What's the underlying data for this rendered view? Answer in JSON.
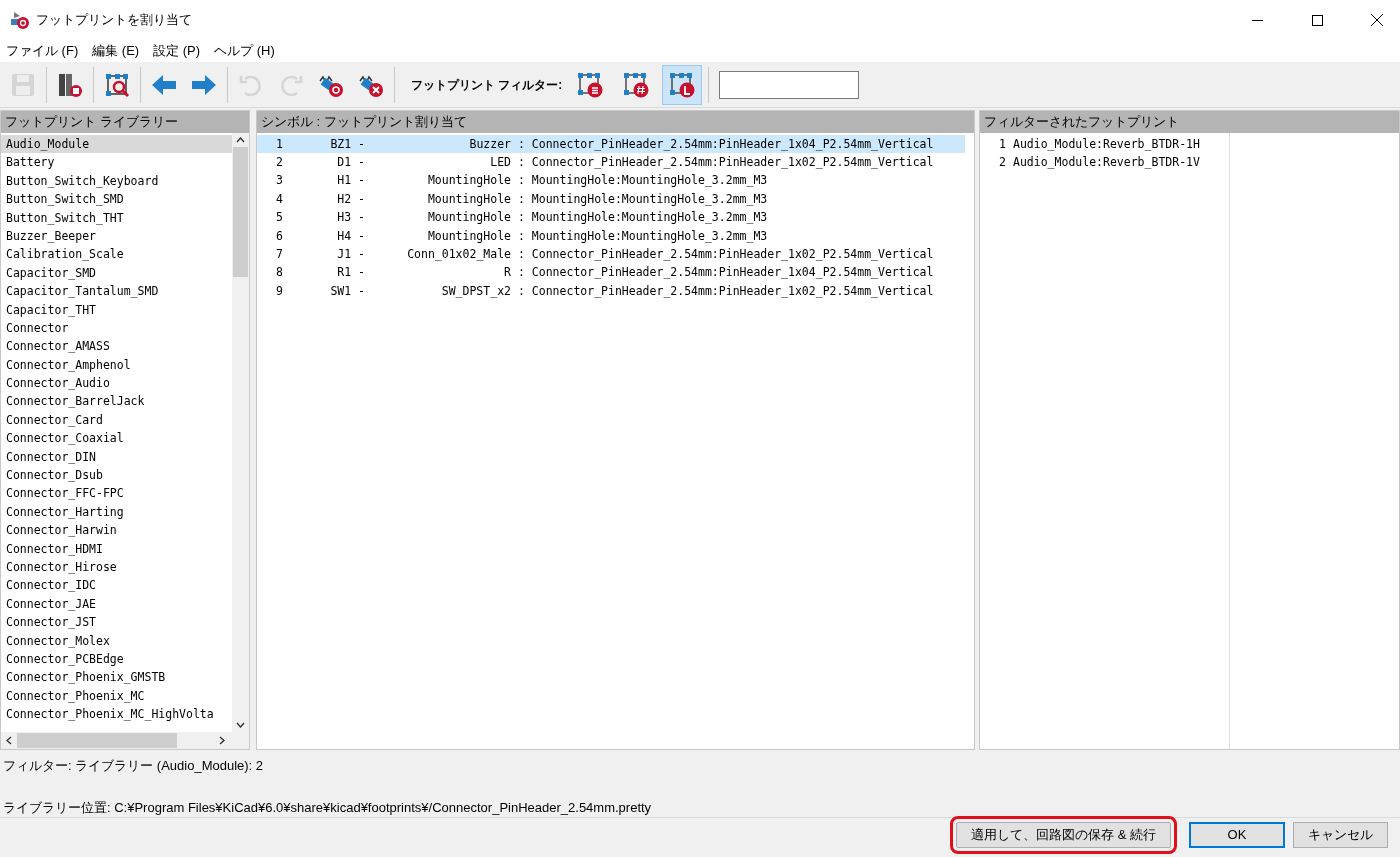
{
  "window": {
    "title": "フットプリントを割り当て"
  },
  "menu": [
    "ファイル (F)",
    "編集 (E)",
    "設定 (P)",
    "ヘルプ (H)"
  ],
  "toolbar": {
    "tools": [
      {
        "kind": "save",
        "disabled": true
      },
      {
        "kind": "library",
        "disabled": false
      },
      {
        "kind": "viewer",
        "disabled": false
      },
      {
        "kind": "prev",
        "disabled": false
      },
      {
        "kind": "next",
        "disabled": false
      },
      {
        "kind": "undo",
        "disabled": true
      },
      {
        "kind": "redo",
        "disabled": true
      },
      {
        "kind": "auto",
        "disabled": false
      },
      {
        "kind": "clear",
        "disabled": false
      }
    ],
    "filter_label": "フットプリント フィルター:",
    "filters": [
      {
        "kind": "keywords",
        "selected": false
      },
      {
        "kind": "pincount",
        "selected": false
      },
      {
        "kind": "library",
        "selected": true
      }
    ]
  },
  "libraries": {
    "title": "フットプリント ライブラリー",
    "items": [
      {
        "label": "Audio_Module",
        "selected": true
      },
      {
        "label": "Battery",
        "selected": false
      },
      {
        "label": "Button_Switch_Keyboard",
        "selected": false
      },
      {
        "label": "Button_Switch_SMD",
        "selected": false
      },
      {
        "label": "Button_Switch_THT",
        "selected": false
      },
      {
        "label": "Buzzer_Beeper",
        "selected": false
      },
      {
        "label": "Calibration_Scale",
        "selected": false
      },
      {
        "label": "Capacitor_SMD",
        "selected": false
      },
      {
        "label": "Capacitor_Tantalum_SMD",
        "selected": false
      },
      {
        "label": "Capacitor_THT",
        "selected": false
      },
      {
        "label": "Connector",
        "selected": false
      },
      {
        "label": "Connector_AMASS",
        "selected": false
      },
      {
        "label": "Connector_Amphenol",
        "selected": false
      },
      {
        "label": "Connector_Audio",
        "selected": false
      },
      {
        "label": "Connector_BarrelJack",
        "selected": false
      },
      {
        "label": "Connector_Card",
        "selected": false
      },
      {
        "label": "Connector_Coaxial",
        "selected": false
      },
      {
        "label": "Connector_DIN",
        "selected": false
      },
      {
        "label": "Connector_Dsub",
        "selected": false
      },
      {
        "label": "Connector_FFC-FPC",
        "selected": false
      },
      {
        "label": "Connector_Harting",
        "selected": false
      },
      {
        "label": "Connector_Harwin",
        "selected": false
      },
      {
        "label": "Connector_HDMI",
        "selected": false
      },
      {
        "label": "Connector_Hirose",
        "selected": false
      },
      {
        "label": "Connector_IDC",
        "selected": false
      },
      {
        "label": "Connector_JAE",
        "selected": false
      },
      {
        "label": "Connector_JST",
        "selected": false
      },
      {
        "label": "Connector_Molex",
        "selected": false
      },
      {
        "label": "Connector_PCBEdge",
        "selected": false
      },
      {
        "label": "Connector_Phoenix_GMSTB",
        "selected": false
      },
      {
        "label": "Connector_Phoenix_MC",
        "selected": false
      },
      {
        "label": "Connector_Phoenix_MC_HighVolta",
        "selected": false
      }
    ]
  },
  "assignments": {
    "title": "シンボル : フットプリント割り当て",
    "rows": [
      {
        "index": "1",
        "ref": "BZ1 -",
        "value": "Buzzer",
        "footprint": ": Connector_PinHeader_2.54mm:PinHeader_1x04_P2.54mm_Vertical",
        "selected": true
      },
      {
        "index": "2",
        "ref": "D1 -",
        "value": "LED",
        "footprint": ": Connector_PinHeader_2.54mm:PinHeader_1x02_P2.54mm_Vertical",
        "selected": false
      },
      {
        "index": "3",
        "ref": "H1 -",
        "value": "MountingHole",
        "footprint": ": MountingHole:MountingHole_3.2mm_M3",
        "selected": false
      },
      {
        "index": "4",
        "ref": "H2 -",
        "value": "MountingHole",
        "footprint": ": MountingHole:MountingHole_3.2mm_M3",
        "selected": false
      },
      {
        "index": "5",
        "ref": "H3 -",
        "value": "MountingHole",
        "footprint": ": MountingHole:MountingHole_3.2mm_M3",
        "selected": false
      },
      {
        "index": "6",
        "ref": "H4 -",
        "value": "MountingHole",
        "footprint": ": MountingHole:MountingHole_3.2mm_M3",
        "selected": false
      },
      {
        "index": "7",
        "ref": "J1 -",
        "value": "Conn_01x02_Male",
        "footprint": ": Connector_PinHeader_2.54mm:PinHeader_1x02_P2.54mm_Vertical",
        "selected": false
      },
      {
        "index": "8",
        "ref": "R1 -",
        "value": "R",
        "footprint": ": Connector_PinHeader_2.54mm:PinHeader_1x04_P2.54mm_Vertical",
        "selected": false
      },
      {
        "index": "9",
        "ref": "SW1 -",
        "value": "SW_DPST_x2",
        "footprint": ": Connector_PinHeader_2.54mm:PinHeader_1x02_P2.54mm_Vertical",
        "selected": false
      }
    ]
  },
  "filtered": {
    "title": "フィルターされたフットプリント",
    "items": [
      {
        "index": "1",
        "name": "Audio_Module:Reverb_BTDR-1H"
      },
      {
        "index": "2",
        "name": "Audio_Module:Reverb_BTDR-1V"
      }
    ]
  },
  "status": [
    "フィルター: ライブラリー (Audio_Module): 2",
    "ライブラリー位置: C:¥Program Files¥KiCad¥6.0¥share¥kicad¥footprints¥/Connector_PinHeader_2.54mm.pretty"
  ],
  "buttons": [
    {
      "label": "適用して、回路図の保存 & 続行",
      "circled": true,
      "default": false
    },
    {
      "label": "OK",
      "circled": false,
      "default": true
    },
    {
      "label": "キャンセル",
      "circled": false,
      "default": false
    }
  ]
}
